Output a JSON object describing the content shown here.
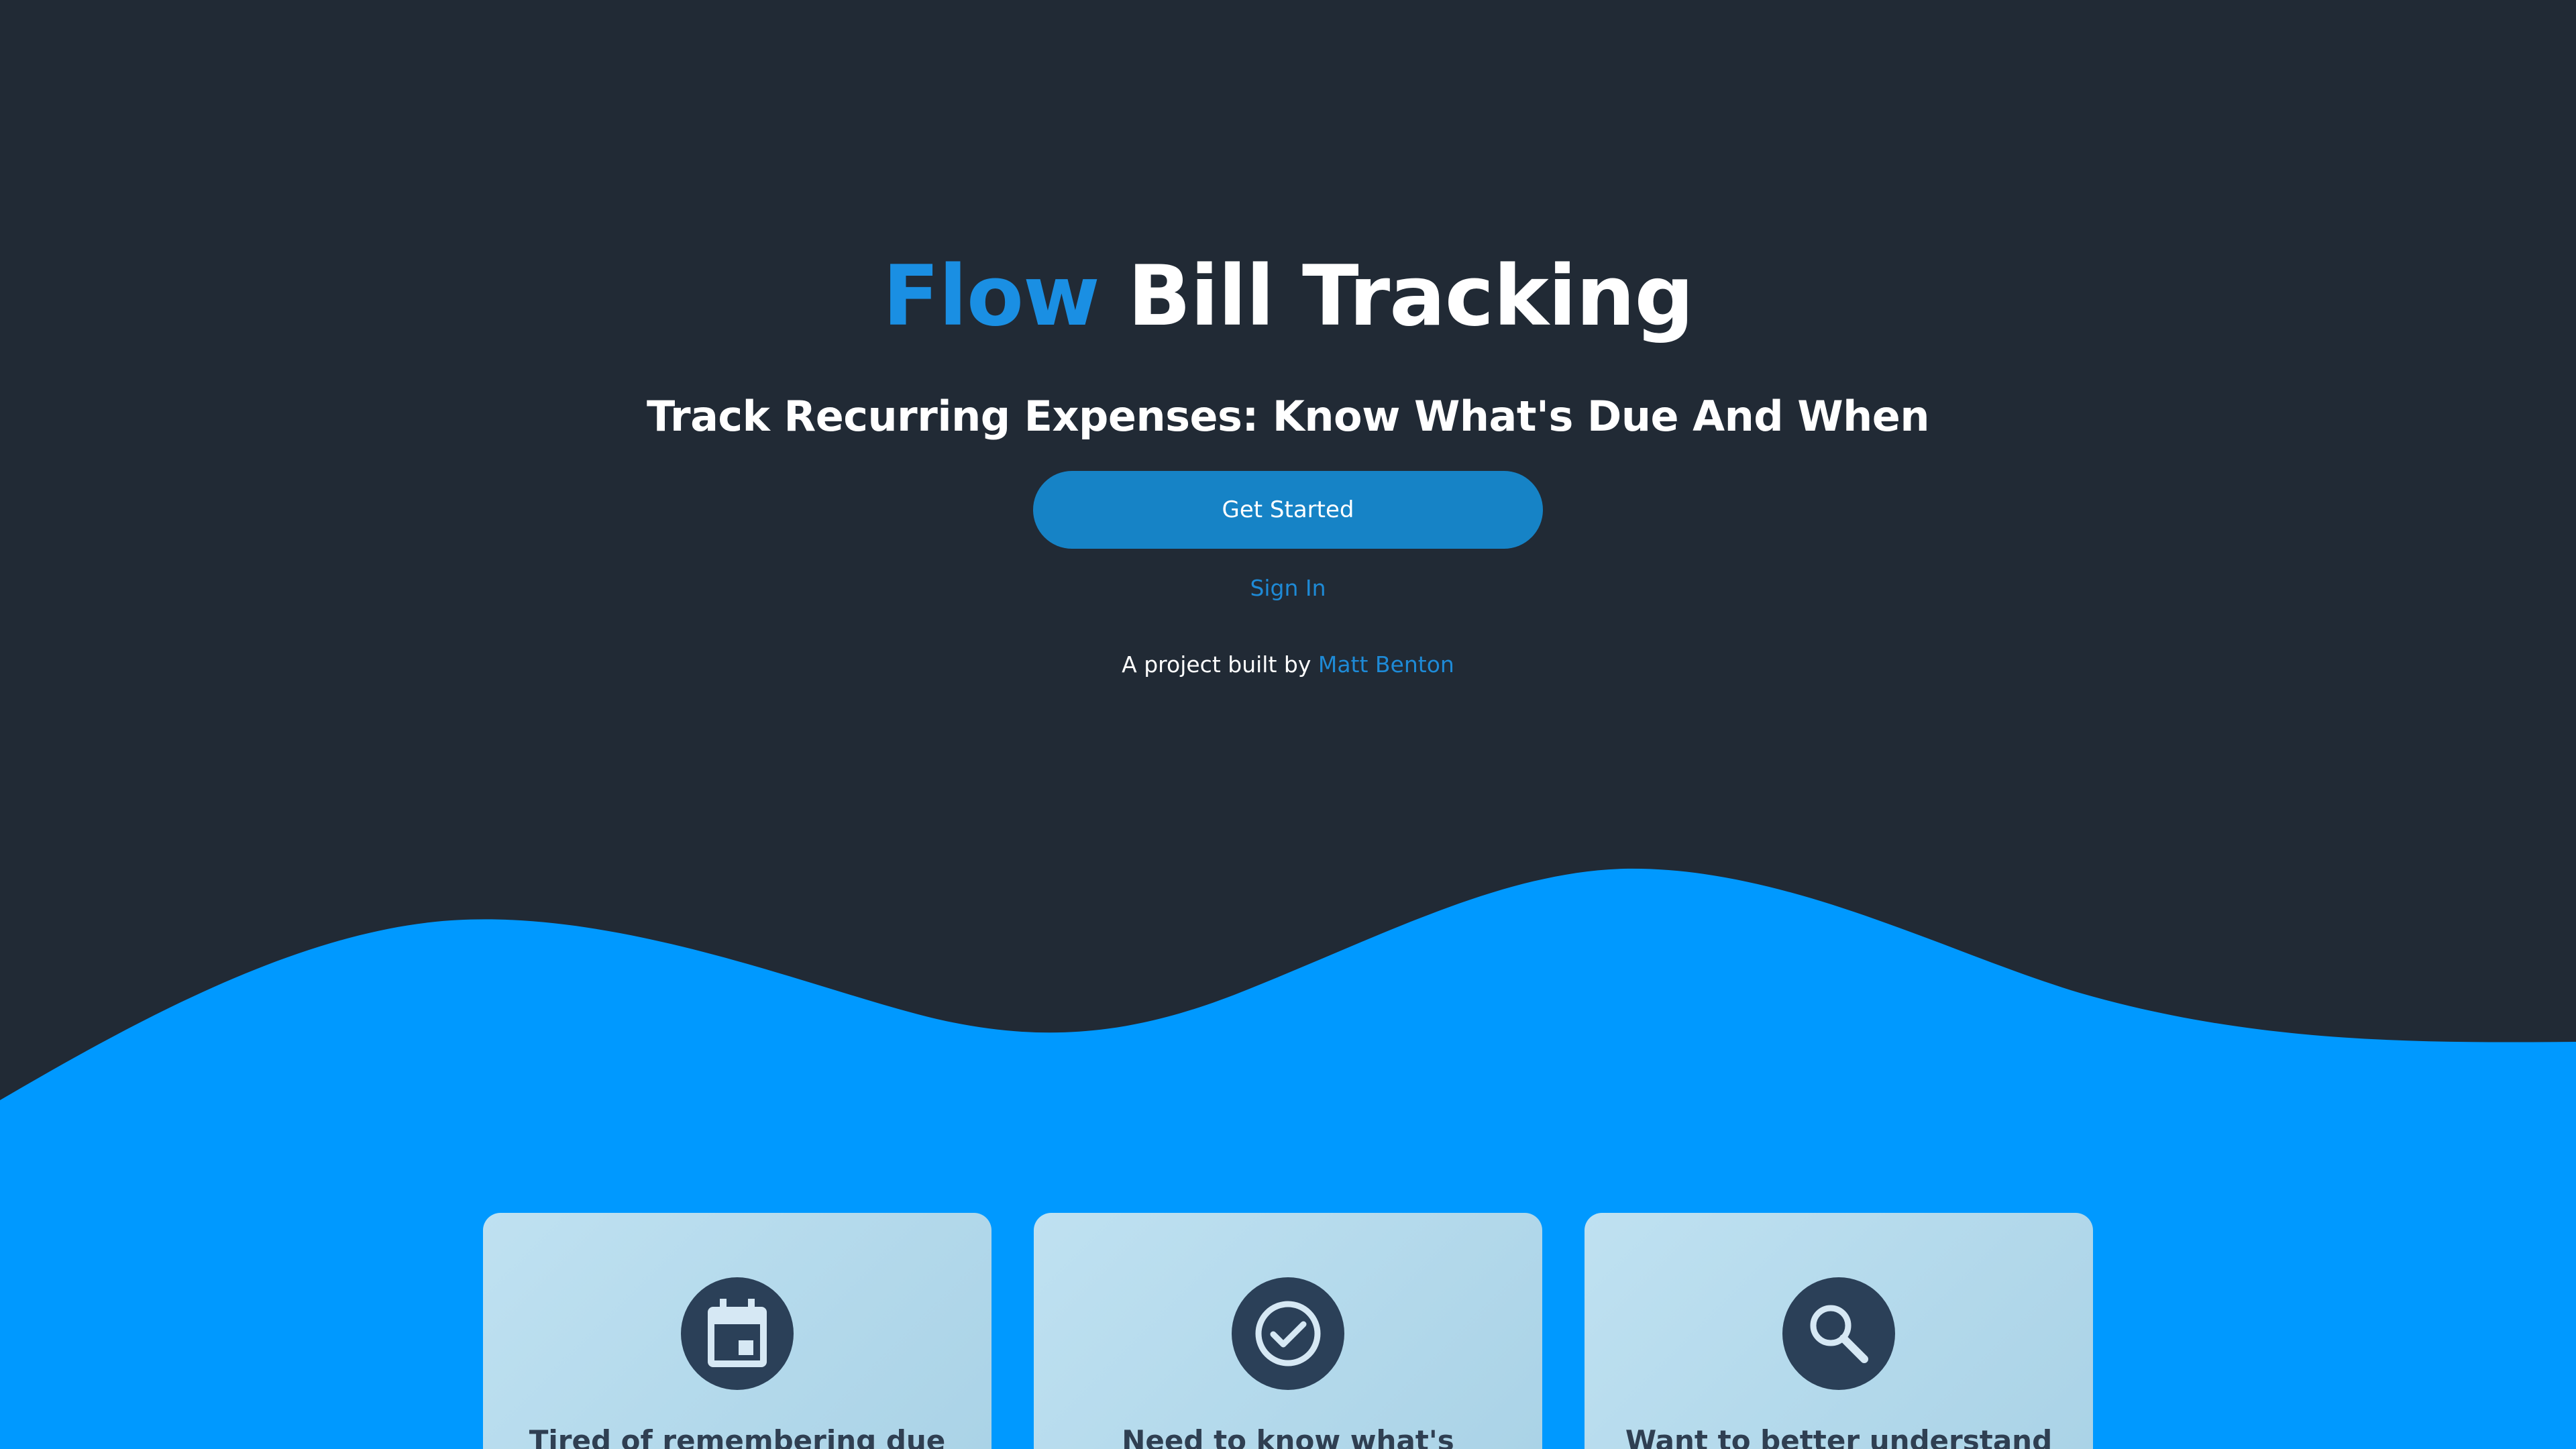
{
  "hero": {
    "title_accent": "Flow",
    "title_rest": "Bill Tracking",
    "subtitle": "Track Recurring Expenses: Know What's Due And When",
    "cta_label": "Get Started",
    "signin_label": "Sign In",
    "credit_prefix": "A project built by",
    "credit_name": "Matt Benton"
  },
  "features": [
    {
      "icon": "calendar-icon",
      "text": "Tired of remembering due"
    },
    {
      "icon": "check-circle-icon",
      "text": "Need to know what's already"
    },
    {
      "icon": "search-icon",
      "text": "Want to better understand"
    }
  ],
  "colors": {
    "background": "#212a35",
    "accent": "#1a8fe3",
    "wave": "#0099ff",
    "button": "#1683c6",
    "icon_circle": "#2b4058"
  }
}
